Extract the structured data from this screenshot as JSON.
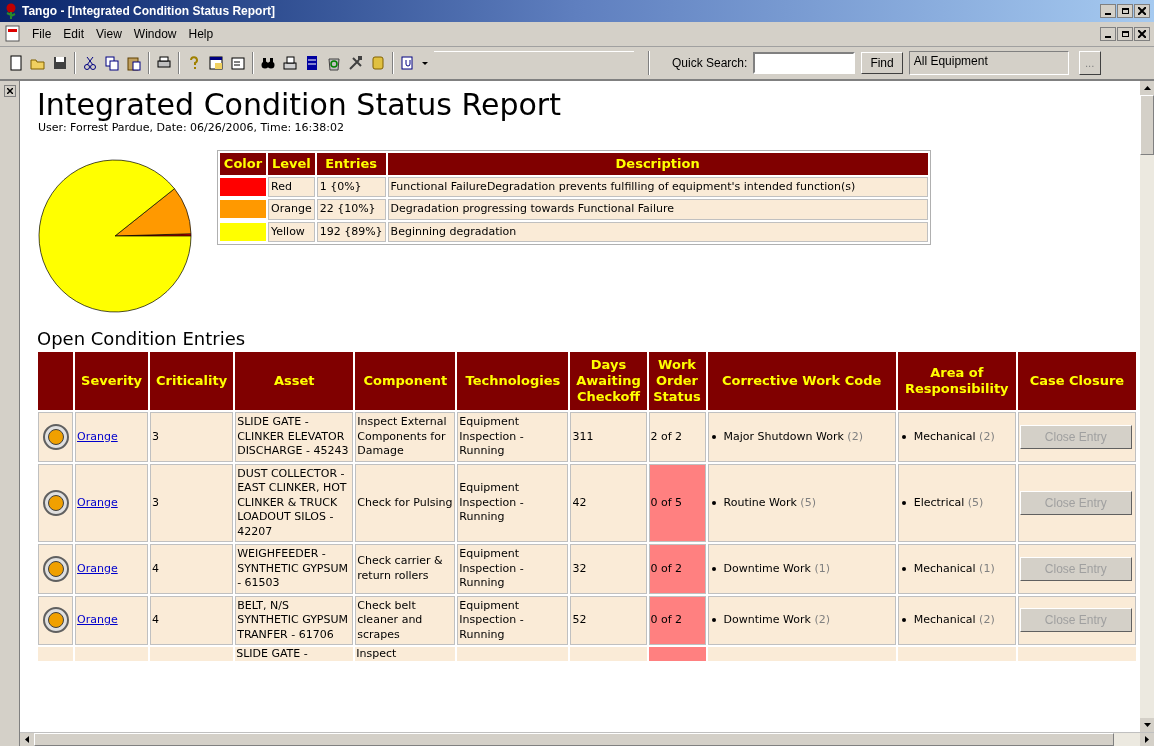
{
  "window": {
    "title": "Tango - [Integrated Condition Status Report]"
  },
  "menu": [
    "File",
    "Edit",
    "View",
    "Window",
    "Help"
  ],
  "toolbar": {
    "quick_search_label": "Quick Search:",
    "find_button": "Find",
    "scope": "All Equipment",
    "browse_button": "..."
  },
  "report": {
    "title": "Integrated Condition Status Report",
    "subtitle": "User: Forrest Pardue, Date: 06/26/2006, Time: 16:38:02",
    "legend": {
      "columns": [
        "Color",
        "Level",
        "Entries",
        "Description"
      ],
      "rows": [
        {
          "color": "#ff0000",
          "level": "Red",
          "entries": "1 {0%}",
          "description": "Functional FailureDegradation prevents fulfilling of equipment's intended function(s)"
        },
        {
          "color": "#ff9900",
          "level": "Orange",
          "entries": "22 {10%}",
          "description": "Degradation progressing towards Functional Failure"
        },
        {
          "color": "#ffff00",
          "level": "Yellow",
          "entries": "192 {89%}",
          "description": "Beginning degradation"
        }
      ]
    }
  },
  "entries": {
    "heading": "Open Condition Entries",
    "columns": [
      "Severity",
      "Criticality",
      "Asset",
      "Component",
      "Technologies",
      "Days Awaiting Checkoff",
      "Work Order Status",
      "Corrective Work Code",
      "Area of Responsibility",
      "Case Closure"
    ],
    "rows": [
      {
        "kind": "full",
        "color": "#f0a000",
        "severity": "Orange",
        "criticality": "3",
        "asset": "SLIDE GATE - CLINKER ELEVATOR DISCHARGE - 45243",
        "component": "Inspect External Components for Damage",
        "technologies": "Equipment Inspection - Running",
        "days": "311",
        "work_order_status": "2 of 2",
        "overdue": false,
        "work_code": {
          "name": "Major Shutdown Work",
          "count": "(2)"
        },
        "area": {
          "name": "Mechanical",
          "count": "(2)"
        },
        "close_button": "Close Entry",
        "close_disabled": true
      },
      {
        "kind": "full",
        "color": "#f0a000",
        "severity": "Orange",
        "criticality": "3",
        "asset": "DUST COLLECTOR - EAST CLINKER, HOT CLINKER & TRUCK LOADOUT SILOS - 42207",
        "component": "Check for Pulsing",
        "technologies": "Equipment Inspection - Running",
        "days": "42",
        "work_order_status": "0 of 5",
        "overdue": true,
        "work_code": {
          "name": "Routine Work",
          "count": "(5)"
        },
        "area": {
          "name": "Electrical",
          "count": "(5)"
        },
        "close_button": "Close Entry",
        "close_disabled": true
      },
      {
        "kind": "full",
        "color": "#f0a000",
        "severity": "Orange",
        "criticality": "4",
        "asset": "WEIGHFEEDER - SYNTHETIC GYPSUM - 61503",
        "component": "Check carrier & return rollers",
        "technologies": "Equipment Inspection - Running",
        "days": "32",
        "work_order_status": "0 of 2",
        "overdue": true,
        "work_code": {
          "name": "Downtime Work",
          "count": "(1)"
        },
        "area": {
          "name": "Mechanical",
          "count": "(1)"
        },
        "close_button": "Close Entry",
        "close_disabled": true
      },
      {
        "kind": "full",
        "color": "#f0a000",
        "severity": "Orange",
        "criticality": "4",
        "asset": "BELT, N/S SYNTHETIC GYPSUM TRANFER - 61706",
        "component": "Check belt cleaner and scrapes",
        "technologies": "Equipment Inspection - Running",
        "days": "52",
        "work_order_status": "0 of 2",
        "overdue": true,
        "work_code": {
          "name": "Downtime Work",
          "count": "(2)"
        },
        "area": {
          "name": "Mechanical",
          "count": "(2)"
        },
        "close_button": "Close Entry",
        "close_disabled": true
      },
      {
        "kind": "partial",
        "asset": "SLIDE GATE -",
        "component": "Inspect",
        "overdue": true
      }
    ]
  }
}
